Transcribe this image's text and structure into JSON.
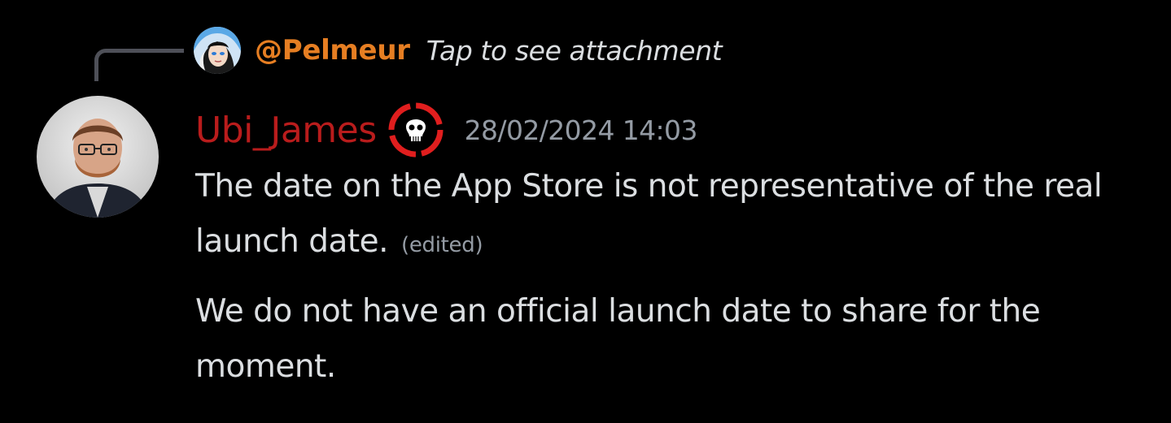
{
  "reply": {
    "author": "@Pelmeur",
    "preview": "Tap to see attachment"
  },
  "message": {
    "author": "Ubi_James",
    "timestamp": "28/02/2024 14:03",
    "paragraphs": [
      {
        "text": "The date on the App Store is not representative of the real launch date.",
        "edited_label": "(edited)"
      },
      {
        "text": "We do not have an official launch date to share for the moment."
      }
    ]
  },
  "icons": {
    "reply_avatar": "anime-character-avatar-icon",
    "main_avatar": "user-portrait-avatar",
    "role_badge": "skull-crosshair-badge-icon"
  },
  "colors": {
    "background": "#000000",
    "reply_author": "#e67e22",
    "author": "#b91c1c",
    "text": "#dbdee1",
    "muted": "#949ba4",
    "reply_line": "#4e5058"
  }
}
